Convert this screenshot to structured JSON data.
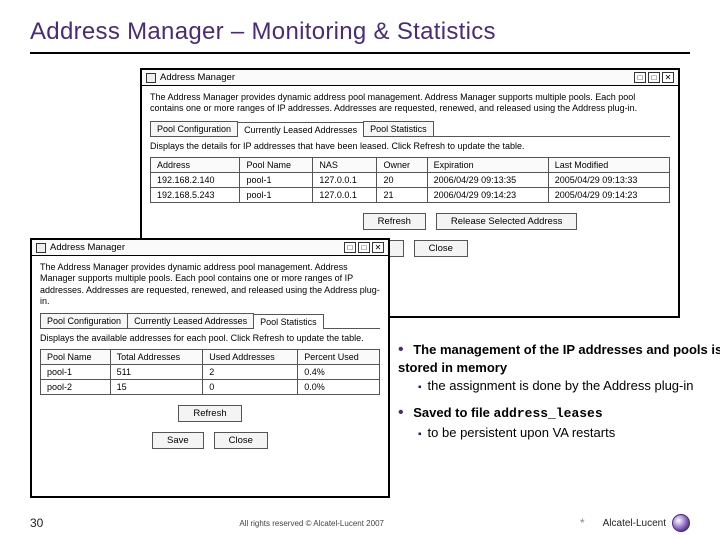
{
  "slide": {
    "title": "Address Manager – Monitoring & Statistics",
    "page_number": "30",
    "footer_mid": "All rights reserved © Alcatel-Lucent 2007",
    "footer_brand": "Alcatel-Lucent",
    "footer_star": "*"
  },
  "win_main": {
    "title": "Address Manager",
    "desc": "The Address Manager provides dynamic address pool management. Address Manager supports multiple pools. Each pool contains one or more ranges of IP addresses. Addresses are requested, renewed, and released using the Address plug-in.",
    "tabs": {
      "t0": "Pool Configuration",
      "t1": "Currently Leased Addresses",
      "t2": "Pool Statistics"
    },
    "subdesc": "Displays the details for IP addresses that have been leased. Click Refresh to update the table.",
    "cols": {
      "c0": "Address",
      "c1": "Pool Name",
      "c2": "NAS",
      "c3": "Owner",
      "c4": "Expiration",
      "c5": "Last Modified"
    },
    "r0": {
      "c0": "192.168.2.140",
      "c1": "pool-1",
      "c2": "127.0.0.1",
      "c3": "20",
      "c4": "2006/04/29 09:13:35",
      "c5": "2005/04/29 09:13:33"
    },
    "r1": {
      "c0": "192.168.5.243",
      "c1": "pool-1",
      "c2": "127.0.0.1",
      "c3": "21",
      "c4": "2006/04/29 09:14:23",
      "c5": "2005/04/29 09:14:23"
    },
    "btns": {
      "refresh": "Refresh",
      "release": "Release Selected Address",
      "save": "Save",
      "close": "Close"
    }
  },
  "win_stats": {
    "title": "Address Manager",
    "desc": "The Address Manager provides dynamic address pool management. Address Manager supports multiple pools. Each pool contains one or more ranges of IP addresses. Addresses are requested, renewed, and released using the Address plug-in.",
    "tabs": {
      "t0": "Pool Configuration",
      "t1": "Currently Leased Addresses",
      "t2": "Pool Statistics"
    },
    "subdesc": "Displays the available addresses for each pool. Click Refresh to update the table.",
    "cols": {
      "c0": "Pool Name",
      "c1": "Total Addresses",
      "c2": "Used Addresses",
      "c3": "Percent Used"
    },
    "r0": {
      "c0": "pool-1",
      "c1": "511",
      "c2": "2",
      "c3": "0.4%"
    },
    "r1": {
      "c0": "pool-2",
      "c1": "15",
      "c2": "0",
      "c3": "0.0%"
    },
    "btns": {
      "refresh": "Refresh",
      "save": "Save",
      "close": "Close"
    }
  },
  "bullets": {
    "b0": "The management of the IP addresses and pools is stored in memory",
    "b0s0": "the assignment is done by the Address plug-in",
    "b1_pre": "Saved to file ",
    "b1_code": "address_leases",
    "b1s0": "to be persistent upon VA restarts"
  },
  "ctrl": {
    "resize": "□",
    "max": "□",
    "close": "✕"
  }
}
